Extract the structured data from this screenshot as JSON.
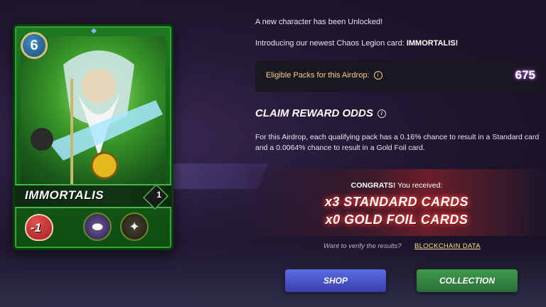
{
  "card": {
    "mana": "6",
    "name": "IMMORTALIS",
    "level": "1",
    "health": "-1",
    "ability_icons": [
      "void-orb-icon",
      "armor-badge-icon"
    ],
    "colors": {
      "frame": "#1f7a22",
      "accent": "#46b54a"
    }
  },
  "unlock_text": "A new character has been Unlocked!",
  "intro": {
    "prefix": "Introducing our newest Chaos Legion card: ",
    "card_name": "IMMORTALIS!"
  },
  "eligible": {
    "label": "Eligible Packs for this Airdrop:",
    "value": "675"
  },
  "claim": {
    "title": "CLAIM REWARD ODDS",
    "odds_text": "For this Airdrop, each qualifying pack has a 0.16% chance to result in a Standard card and a 0.0064% chance to result in a Gold Foil card."
  },
  "result": {
    "congrats_prefix": "CONGRATS!",
    "congrats_suffix": " You received:",
    "line1": "x3 STANDARD CARDS",
    "line2": "x0 GOLD FOIL CARDS"
  },
  "verify": {
    "question": "Want to verify the results?",
    "link": "BLOCKCHAIN DATA"
  },
  "buttons": {
    "shop": "SHOP",
    "collection": "COLLECTION"
  }
}
